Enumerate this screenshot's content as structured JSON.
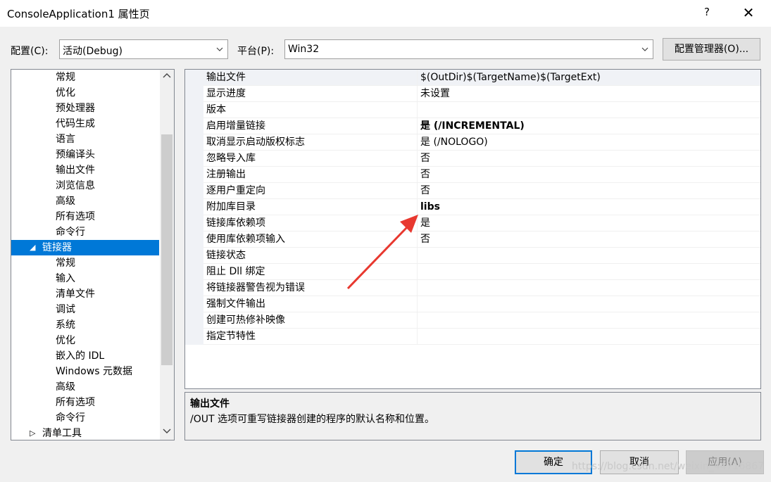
{
  "window": {
    "title": "ConsoleApplication1 属性页",
    "help": "?",
    "close": "✕"
  },
  "toolbar": {
    "config_label": "配置(C):",
    "config_value": "活动(Debug)",
    "platform_label": "平台(P):",
    "platform_value": "Win32",
    "config_manager": "配置管理器(O)..."
  },
  "tree": {
    "items": [
      {
        "label": "常规"
      },
      {
        "label": "优化"
      },
      {
        "label": "预处理器"
      },
      {
        "label": "代码生成"
      },
      {
        "label": "语言"
      },
      {
        "label": "预编译头"
      },
      {
        "label": "输出文件"
      },
      {
        "label": "浏览信息"
      },
      {
        "label": "高级"
      },
      {
        "label": "所有选项"
      },
      {
        "label": "命令行"
      },
      {
        "label": "链接器",
        "expander": "◢",
        "selected": true
      },
      {
        "label": "常规"
      },
      {
        "label": "输入"
      },
      {
        "label": "清单文件"
      },
      {
        "label": "调试"
      },
      {
        "label": "系统"
      },
      {
        "label": "优化"
      },
      {
        "label": "嵌入的 IDL"
      },
      {
        "label": "Windows 元数据"
      },
      {
        "label": "高级"
      },
      {
        "label": "所有选项"
      },
      {
        "label": "命令行"
      },
      {
        "label": "清单工具",
        "expander": "▷"
      }
    ]
  },
  "properties": [
    {
      "name": "输出文件",
      "value": "$(OutDir)$(TargetName)$(TargetExt)",
      "bold": false
    },
    {
      "name": "显示进度",
      "value": "未设置",
      "bold": false
    },
    {
      "name": "版本",
      "value": "",
      "bold": false
    },
    {
      "name": "启用增量链接",
      "value": "是 (/INCREMENTAL)",
      "bold": true
    },
    {
      "name": "取消显示启动版权标志",
      "value": "是 (/NOLOGO)",
      "bold": false
    },
    {
      "name": "忽略导入库",
      "value": "否",
      "bold": false
    },
    {
      "name": "注册输出",
      "value": "否",
      "bold": false
    },
    {
      "name": "逐用户重定向",
      "value": "否",
      "bold": false
    },
    {
      "name": "附加库目录",
      "value": "libs",
      "bold": true
    },
    {
      "name": "链接库依赖项",
      "value": "是",
      "bold": false
    },
    {
      "name": "使用库依赖项输入",
      "value": "否",
      "bold": false
    },
    {
      "name": "链接状态",
      "value": "",
      "bold": false
    },
    {
      "name": "阻止 Dll 绑定",
      "value": "",
      "bold": false
    },
    {
      "name": "将链接器警告视为错误",
      "value": "",
      "bold": false
    },
    {
      "name": "强制文件输出",
      "value": "",
      "bold": false
    },
    {
      "name": "创建可热修补映像",
      "value": "",
      "bold": false
    },
    {
      "name": "指定节特性",
      "value": "",
      "bold": false
    }
  ],
  "description": {
    "title": "输出文件",
    "text": "/OUT 选项可重写链接器创建的程序的默认名称和位置。"
  },
  "buttons": {
    "ok": "确定",
    "cancel": "取消",
    "apply": "应用(A)"
  },
  "annotation": {
    "color": "#e8382f"
  },
  "watermark": "https://blog.csdn.net/weixin_44716867"
}
